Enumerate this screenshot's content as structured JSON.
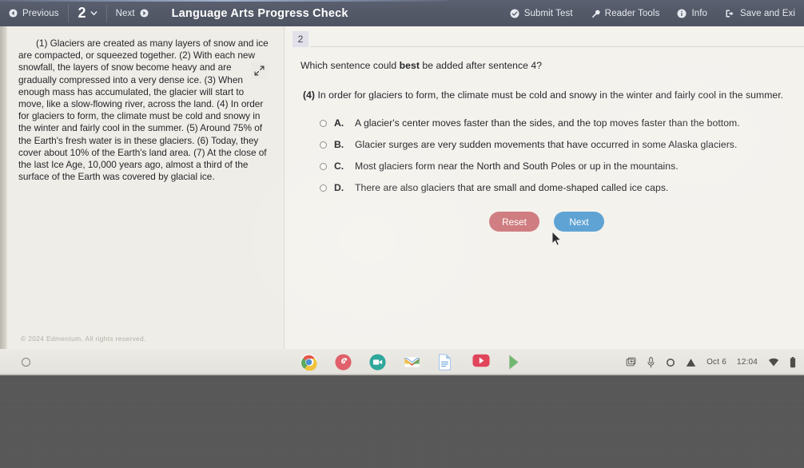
{
  "topbar": {
    "previous_label": "Previous",
    "question_number": "2",
    "next_label": "Next",
    "title": "Language Arts Progress Check",
    "submit_label": "Submit Test",
    "reader_tools_label": "Reader Tools",
    "info_label": "Info",
    "save_exit_label": "Save and Exi"
  },
  "passage": {
    "text": "(1) Glaciers are created as many layers of snow and ice are compacted, or squeezed together. (2) With each new snowfall, the layers of snow become heavy and are gradually compressed into a very dense ice. (3) When enough mass has accumulated, the glacier will start to move, like a slow-flowing river, across the land. (4) In order for glaciers to form, the climate must be cold and snowy in the winter and fairly cool in the summer. (5) Around 75% of the Earth's fresh water is in these glaciers. (6) Today, they cover about 10% of the Earth's land area. (7) At the close of the last Ice Age, 10,000 years ago, almost a third of the surface of the Earth was covered by glacial ice."
  },
  "question": {
    "number": "2",
    "stem_before": "Which sentence could ",
    "stem_bold": "best",
    "stem_after": " be added after sentence 4?",
    "reference_label": "(4)",
    "reference_text": " In order for glaciers to form, the climate must be cold and snowy in the winter and fairly cool in the summer.",
    "choices": [
      {
        "letter": "A.",
        "text": "A glacier's center moves faster than the sides, and the top moves faster than the bottom.",
        "selected": false
      },
      {
        "letter": "B.",
        "text": "Glacier surges are very sudden movements that have occurred in some Alaska glaciers.",
        "selected": false
      },
      {
        "letter": "C.",
        "text": "Most glaciers form near the North and South Poles or up in the mountains.",
        "selected": false
      },
      {
        "letter": "D.",
        "text": "There are also glaciers that are small and dome-shaped called ice caps.",
        "selected": false
      }
    ],
    "reset_label": "Reset",
    "next_label": "Next"
  },
  "footer": {
    "copyright": "© 2024 Edmentum. All rights reserved."
  },
  "shelf": {
    "apps": [
      "chrome-icon",
      "assistant-icon",
      "meet-icon",
      "gmail-icon",
      "docs-icon",
      "youtube-icon",
      "play-store-icon"
    ],
    "date": "Oct 6",
    "time": "12:04"
  },
  "colors": {
    "topbar": "#545a68",
    "reset": "#cf7d80",
    "next": "#5fa3d4",
    "question_badge": "#e2e1ea"
  }
}
